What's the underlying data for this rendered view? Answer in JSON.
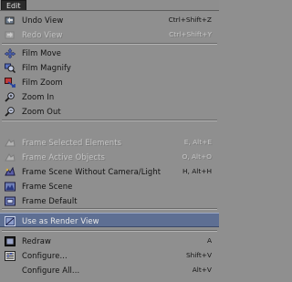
{
  "menubar": {
    "title": "Edit"
  },
  "colors": {
    "menu_bg": "#8f8f8f",
    "highlight": "#5e6f93",
    "disabled_text": "#c4c4c4",
    "text": "#121212"
  },
  "items": [
    {
      "label": "Undo View",
      "shortcut": "Ctrl+Shift+Z",
      "icon": "undo-view-icon",
      "enabled": true
    },
    {
      "label": "Redo View",
      "shortcut": "Ctrl+Shift+Y",
      "icon": "redo-view-icon",
      "enabled": false
    },
    {
      "label": "Film Move",
      "shortcut": "",
      "icon": "film-move-icon",
      "enabled": true
    },
    {
      "label": "Film Magnify",
      "shortcut": "",
      "icon": "film-magnify-icon",
      "enabled": true
    },
    {
      "label": "Film Zoom",
      "shortcut": "",
      "icon": "film-zoom-icon",
      "enabled": true
    },
    {
      "label": "Zoom In",
      "shortcut": "",
      "icon": "zoom-in-icon",
      "enabled": true
    },
    {
      "label": "Zoom Out",
      "shortcut": "",
      "icon": "zoom-out-icon",
      "enabled": true
    },
    {
      "label": "Frame Selected Elements",
      "shortcut": "E, Alt+E",
      "icon": "frame-selected-icon",
      "enabled": false
    },
    {
      "label": "Frame Active Objects",
      "shortcut": "O, Alt+O",
      "icon": "frame-active-icon",
      "enabled": false
    },
    {
      "label": "Frame Scene Without Camera/Light",
      "shortcut": "H, Alt+H",
      "icon": "frame-scene-without-camera-icon",
      "enabled": true
    },
    {
      "label": "Frame Scene",
      "shortcut": "",
      "icon": "frame-scene-icon",
      "enabled": true
    },
    {
      "label": "Frame Default",
      "shortcut": "",
      "icon": "frame-default-icon",
      "enabled": true
    },
    {
      "label": "Use as Render View",
      "shortcut": "",
      "icon": "render-view-icon",
      "enabled": true,
      "highlighted": true
    },
    {
      "label": "Redraw",
      "shortcut": "A",
      "icon": "redraw-icon",
      "enabled": true
    },
    {
      "label": "Configure...",
      "shortcut": "Shift+V",
      "icon": "configure-icon",
      "enabled": true
    },
    {
      "label": "Configure All...",
      "shortcut": "Alt+V",
      "icon": "",
      "enabled": true
    }
  ]
}
